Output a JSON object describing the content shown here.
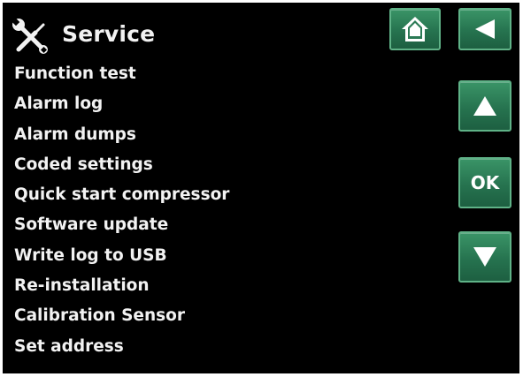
{
  "header": {
    "title": "Service",
    "icon": "tools-icon"
  },
  "nav": {
    "home_icon": "home-icon",
    "back_icon": "back-arrow-icon"
  },
  "side_controls": {
    "up_icon": "arrow-up-icon",
    "ok_label": "OK",
    "down_icon": "arrow-down-icon"
  },
  "menu": {
    "items": [
      {
        "label": "Function test"
      },
      {
        "label": "Alarm log"
      },
      {
        "label": "Alarm dumps"
      },
      {
        "label": "Coded settings"
      },
      {
        "label": "Quick start compressor"
      },
      {
        "label": "Software update"
      },
      {
        "label": "Write log to USB"
      },
      {
        "label": "Re-installation"
      },
      {
        "label": "Calibration Sensor"
      },
      {
        "label": "Set address"
      }
    ]
  },
  "colors": {
    "screen_background": "#000000",
    "text": "#f2f2f2",
    "button_green": "#2b7a55",
    "button_border": "#5fb287"
  }
}
